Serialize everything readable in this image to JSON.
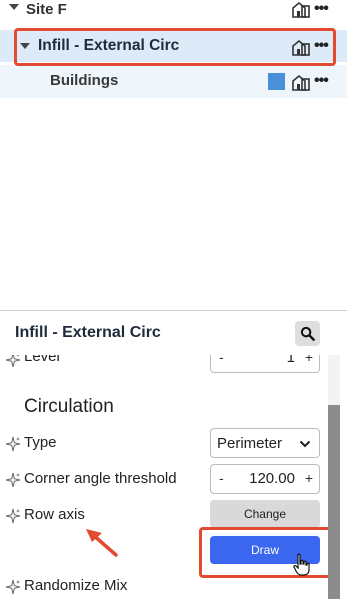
{
  "tree": {
    "site": {
      "label": "Site F"
    },
    "infill": {
      "label": "Infill - External Circ"
    },
    "buildings": {
      "label": "Buildings",
      "swatch_color": "#4a90d9"
    },
    "row_icons": [
      "building-icon",
      "more-dots-icon"
    ],
    "more_label": "•••"
  },
  "panel": {
    "title": "Infill - External Circ",
    "level": {
      "label": "Level",
      "minus": "-",
      "plus": "+",
      "value": "1"
    },
    "section_title": "Circulation",
    "type": {
      "label": "Type",
      "value": "Perimeter"
    },
    "corner_angle": {
      "label": "Corner angle threshold",
      "minus": "-",
      "plus": "+",
      "value": "120.00"
    },
    "row_axis": {
      "label": "Row axis",
      "change_label": "Change",
      "draw_label": "Draw"
    },
    "randomize": {
      "label": "Randomize Mix"
    }
  },
  "colors": {
    "highlight": "#e24b2f",
    "selected_row": "#dcebf7",
    "primary_button": "#3a66f0",
    "secondary_button": "#d9d9d9"
  }
}
